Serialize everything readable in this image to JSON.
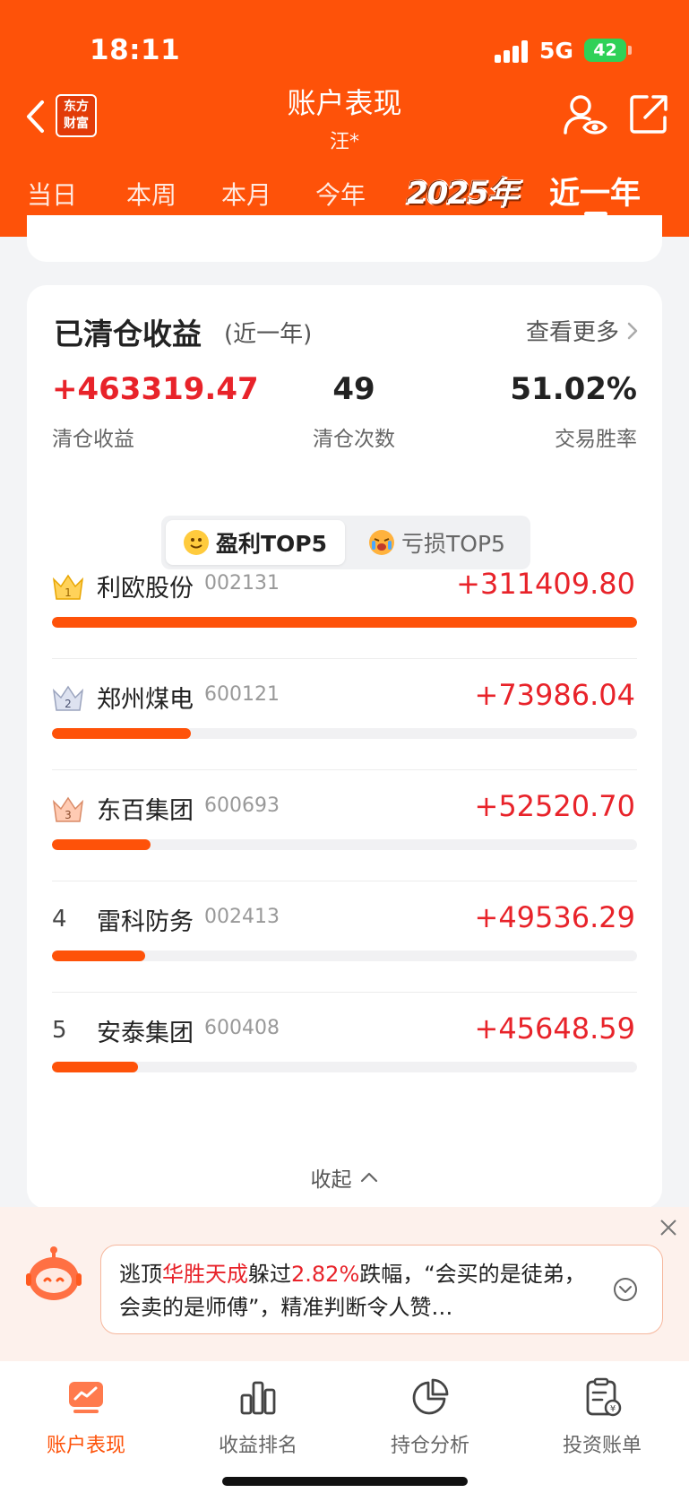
{
  "status_bar": {
    "time": "18:11",
    "network": "5G",
    "battery": "42"
  },
  "header": {
    "logo_line1": "东方",
    "logo_line2": "财富",
    "title": "账户表现",
    "subtitle": "汪*",
    "tabs": [
      {
        "label": "当日"
      },
      {
        "label": "本周"
      },
      {
        "label": "本月"
      },
      {
        "label": "今年"
      },
      {
        "label": "2025年"
      },
      {
        "label": "近一年"
      }
    ],
    "active_tab": "近一年"
  },
  "closed_card": {
    "title": "已清仓收益",
    "range": "(近一年)",
    "see_more": "查看更多",
    "stats": [
      {
        "value": "+463319.47",
        "label": "清仓收益"
      },
      {
        "value": "49",
        "label": "清仓次数"
      },
      {
        "value": "51.02%",
        "label": "交易胜率"
      }
    ],
    "toggle": {
      "profit_label": "盈利TOP5",
      "loss_label": "亏损TOP5",
      "selected": "盈利TOP5"
    },
    "ranking": [
      {
        "rank": "1",
        "name": "利欧股份",
        "code": "002131",
        "profit": "+311409.80",
        "amount": 311409.8
      },
      {
        "rank": "2",
        "name": "郑州煤电",
        "code": "600121",
        "profit": "+73986.04",
        "amount": 73986.04
      },
      {
        "rank": "3",
        "name": "东百集团",
        "code": "600693",
        "profit": "+52520.70",
        "amount": 52520.7
      },
      {
        "rank": "4",
        "name": "雷科防务",
        "code": "002413",
        "profit": "+49536.29",
        "amount": 49536.29
      },
      {
        "rank": "5",
        "name": "安泰集团",
        "code": "600408",
        "profit": "+45648.59",
        "amount": 45648.59
      }
    ],
    "collapse_label": "收起"
  },
  "ai_banner": {
    "text_pre": "逃顶",
    "text_stock": "华胜天成",
    "text_mid": "躲过",
    "text_pct": "2.82%",
    "text_post": "跌幅，“会买的是徒弟，会卖的是师傅”，精准判断令人赞…"
  },
  "bottom_nav": [
    {
      "label": "账户表现",
      "icon": "chart-card-icon"
    },
    {
      "label": "收益排名",
      "icon": "bar-chart-icon"
    },
    {
      "label": "持仓分析",
      "icon": "pie-chart-icon"
    },
    {
      "label": "投资账单",
      "icon": "bill-icon"
    }
  ],
  "colors": {
    "brand": "#fe5209",
    "profit_red": "#e8232a",
    "battery_green": "#2fd158"
  }
}
